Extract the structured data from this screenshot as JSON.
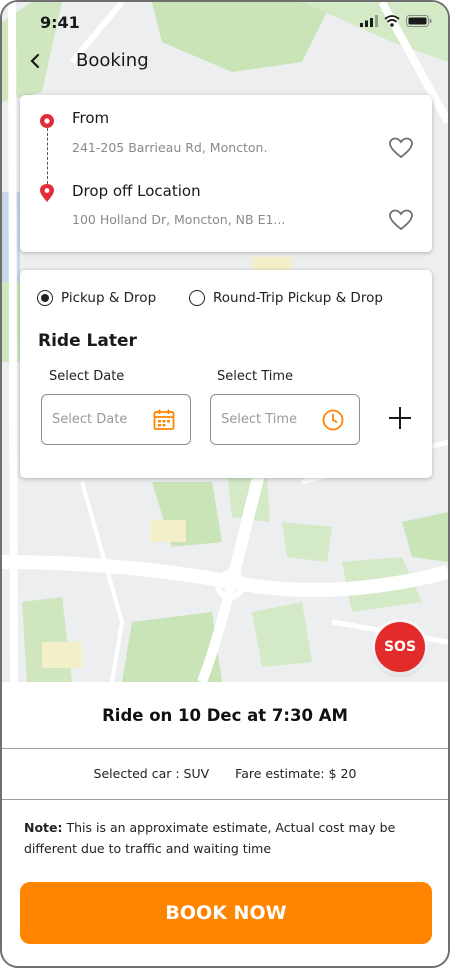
{
  "status_bar": {
    "time": "9:41"
  },
  "header": {
    "title": "Booking"
  },
  "route": {
    "from_label": "From",
    "from_value": "241-205 Barrieau Rd, Moncton.",
    "drop_label": "Drop off Location",
    "drop_value": "100 Holland Dr, Moncton, NB E1..."
  },
  "ride_type": {
    "options": [
      {
        "label": "Pickup & Drop",
        "selected": true
      },
      {
        "label": "Round-Trip Pickup & Drop",
        "selected": false
      }
    ]
  },
  "schedule": {
    "title": "Ride Later",
    "date_label": "Select Date",
    "date_placeholder": "Select Date",
    "time_label": "Select Time",
    "time_placeholder": "Select Time"
  },
  "sos": {
    "label": "SOS"
  },
  "summary": {
    "ride_text": "Ride on 10 Dec at 7:30 AM",
    "selected_car": "Selected car : SUV",
    "fare_estimate": "Fare estimate: $ 20",
    "note_prefix": "Note:",
    "note_text": " This is an approximate estimate, Actual cost may be different due to traffic and waiting time"
  },
  "actions": {
    "book_label": "BOOK NOW"
  },
  "colors": {
    "accent": "#ff8500",
    "sos": "#e42b2b",
    "pin": "#e42b3a",
    "map_green": "#c9e4b7",
    "map_road": "#ffffff"
  },
  "icons": {
    "back": "chevron-left-icon",
    "favorite": "heart-outline-icon",
    "calendar": "calendar-icon",
    "clock": "clock-icon",
    "add": "plus-icon"
  }
}
